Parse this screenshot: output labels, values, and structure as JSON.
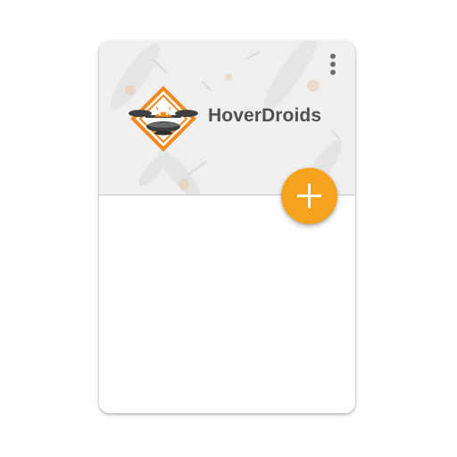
{
  "app": {
    "name": "HoverDroids"
  },
  "header": {
    "logo_icon": "hoverdroids-drone-logo-icon",
    "menu_icon": "more-vertical-icon"
  },
  "fab": {
    "icon": "plus-icon"
  },
  "colors": {
    "accent": "#f5a21e",
    "header_bg": "#efefef",
    "title_text": "#505050",
    "icon_gray": "#6d6d6d"
  }
}
